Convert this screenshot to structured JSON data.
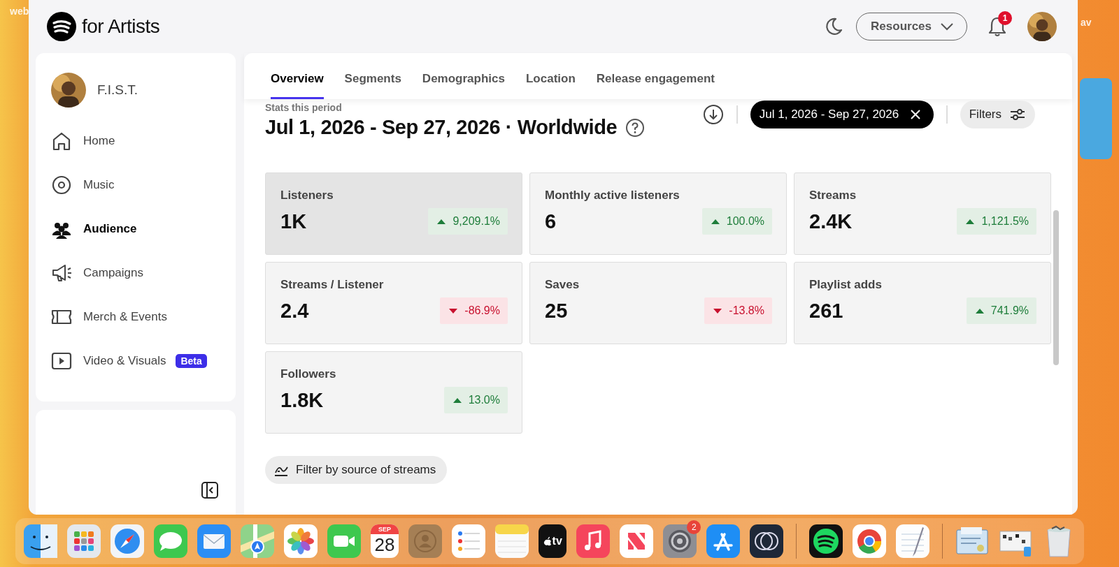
{
  "desktop_labels": [
    {
      "text": "web",
      "kind": "left"
    },
    {
      "text": "av",
      "kind": "right"
    }
  ],
  "header": {
    "brand": "for Artists",
    "resources": "Resources",
    "notifications": "1"
  },
  "sidebar": {
    "artist": "F.I.S.T.",
    "items": [
      {
        "kind": "home",
        "label": "Home",
        "selected": false
      },
      {
        "kind": "music",
        "label": "Music",
        "selected": false
      },
      {
        "kind": "audience",
        "label": "Audience",
        "selected": true
      },
      {
        "kind": "campaigns",
        "label": "Campaigns",
        "selected": false
      },
      {
        "kind": "merch",
        "label": "Merch & Events",
        "selected": false
      },
      {
        "kind": "video",
        "label": "Video & Visuals",
        "selected": false,
        "badge": "Beta"
      }
    ]
  },
  "tabs": [
    {
      "label": "Overview",
      "selected": true
    },
    {
      "label": "Segments",
      "selected": false
    },
    {
      "label": "Demographics",
      "selected": false
    },
    {
      "label": "Location",
      "selected": false
    },
    {
      "label": "Release engagement",
      "selected": false
    }
  ],
  "period": {
    "caption": "Stats this period",
    "title": "Jul 1, 2026 - Sep 27, 2026 · Worldwide",
    "date_chip": "Jul 1, 2026 - Sep 27, 2026",
    "filters": "Filters"
  },
  "stats": [
    {
      "label": "Listeners",
      "value": "1K",
      "change": "9,209.1%",
      "kind": "up",
      "selected": true
    },
    {
      "label": "Monthly active listeners",
      "value": "6",
      "change": "100.0%",
      "kind": "up",
      "selected": false
    },
    {
      "label": "Streams",
      "value": "2.4K",
      "change": "1,121.5%",
      "kind": "up",
      "selected": false
    },
    {
      "label": "Streams / Listener",
      "value": "2.4",
      "change": "-86.9%",
      "kind": "down",
      "selected": false
    },
    {
      "label": "Saves",
      "value": "25",
      "change": "-13.8%",
      "kind": "down",
      "selected": false
    },
    {
      "label": "Playlist adds",
      "value": "261",
      "change": "741.9%",
      "kind": "up",
      "selected": false
    },
    {
      "label": "Followers",
      "value": "1.8K",
      "change": "13.0%",
      "kind": "up",
      "selected": false
    }
  ],
  "source_filter": "Filter by source of streams",
  "dock": [
    {
      "kind": "finder"
    },
    {
      "kind": "launchpad"
    },
    {
      "kind": "safari"
    },
    {
      "kind": "messages"
    },
    {
      "kind": "mail"
    },
    {
      "kind": "maps"
    },
    {
      "kind": "photos"
    },
    {
      "kind": "facetime"
    },
    {
      "kind": "calendar",
      "month": "SEP",
      "day": "28"
    },
    {
      "kind": "contacts"
    },
    {
      "kind": "reminders"
    },
    {
      "kind": "notes"
    },
    {
      "kind": "tv",
      "label": "tv"
    },
    {
      "kind": "music"
    },
    {
      "kind": "news"
    },
    {
      "kind": "settings",
      "badge": "2"
    },
    {
      "kind": "appstore"
    },
    {
      "kind": "rings"
    },
    {
      "kind": "separator"
    },
    {
      "kind": "spotify"
    },
    {
      "kind": "chrome"
    },
    {
      "kind": "textedit"
    },
    {
      "kind": "separator"
    },
    {
      "kind": "certificate"
    },
    {
      "kind": "preview"
    },
    {
      "kind": "trash"
    }
  ]
}
